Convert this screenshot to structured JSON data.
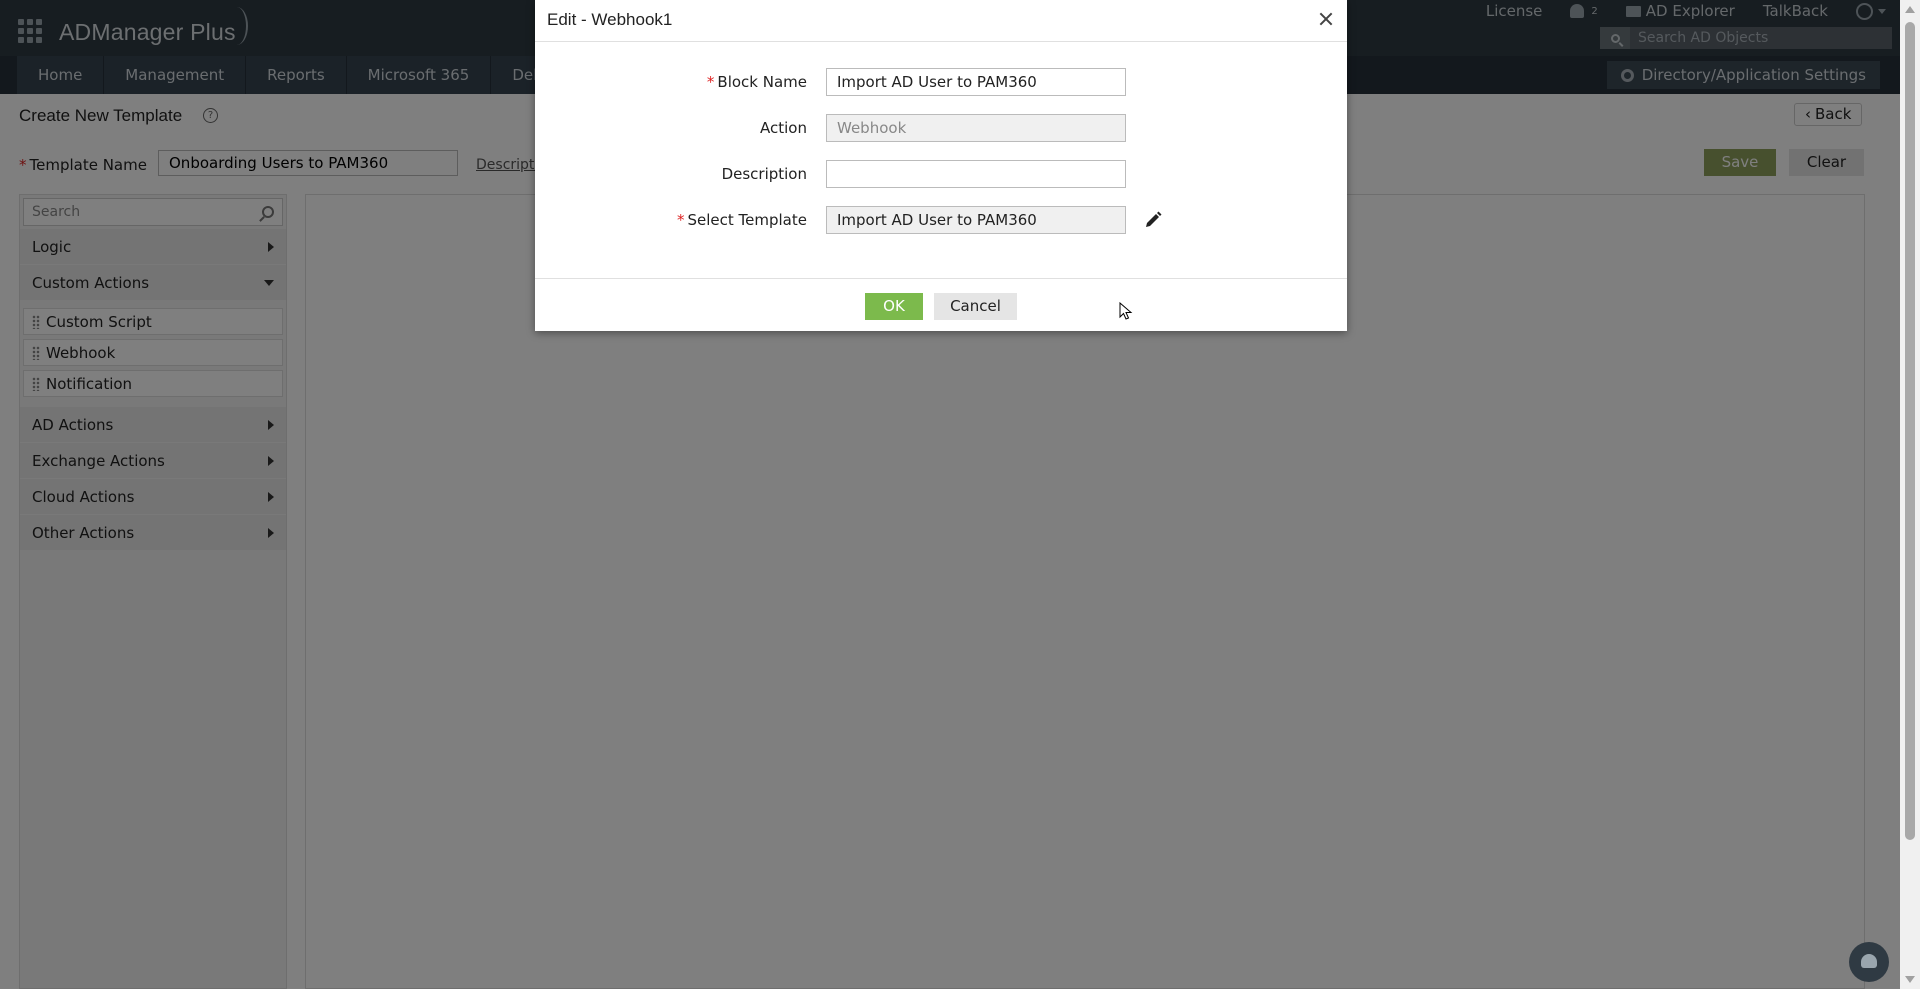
{
  "app": {
    "brand": "ADManager Plus"
  },
  "header": {
    "links": {
      "license": "License",
      "notification_count": "2",
      "ad_explorer": "AD Explorer",
      "talkback": "TalkBack"
    },
    "search_placeholder": "Search AD Objects"
  },
  "nav": {
    "tabs": [
      "Home",
      "Management",
      "Reports",
      "Microsoft 365",
      "Deleg"
    ],
    "settings_label": "Directory/Application Settings"
  },
  "page": {
    "title": "Create New Template",
    "back_label": "Back",
    "template_name_label": "Template Name",
    "template_name_value": "Onboarding Users to PAM360",
    "description_link": "Descripti",
    "save_label": "Save",
    "clear_label": "Clear"
  },
  "sidebar": {
    "search_placeholder": "Search",
    "categories": [
      {
        "label": "Logic",
        "expanded": false
      },
      {
        "label": "Custom Actions",
        "expanded": true,
        "items": [
          "Custom Script",
          "Webhook",
          "Notification"
        ]
      },
      {
        "label": "AD Actions",
        "expanded": false
      },
      {
        "label": "Exchange Actions",
        "expanded": false
      },
      {
        "label": "Cloud Actions",
        "expanded": false
      },
      {
        "label": "Other Actions",
        "expanded": false
      }
    ]
  },
  "modal": {
    "title": "Edit - Webhook1",
    "fields": {
      "block_name": {
        "label": "Block Name",
        "value": "Import AD User to PAM360",
        "required": true
      },
      "action": {
        "label": "Action",
        "value": "Webhook",
        "readonly": true
      },
      "description": {
        "label": "Description",
        "value": ""
      },
      "select_template": {
        "label": "Select Template",
        "value": "Import AD User to PAM360",
        "required": true
      }
    },
    "ok_label": "OK",
    "cancel_label": "Cancel"
  },
  "colors": {
    "header_bg": "#2f3a43",
    "nav_bg": "#26303a",
    "ok_green": "#7cba4c",
    "save_green": "#8ea05c",
    "required_red": "#d22"
  }
}
